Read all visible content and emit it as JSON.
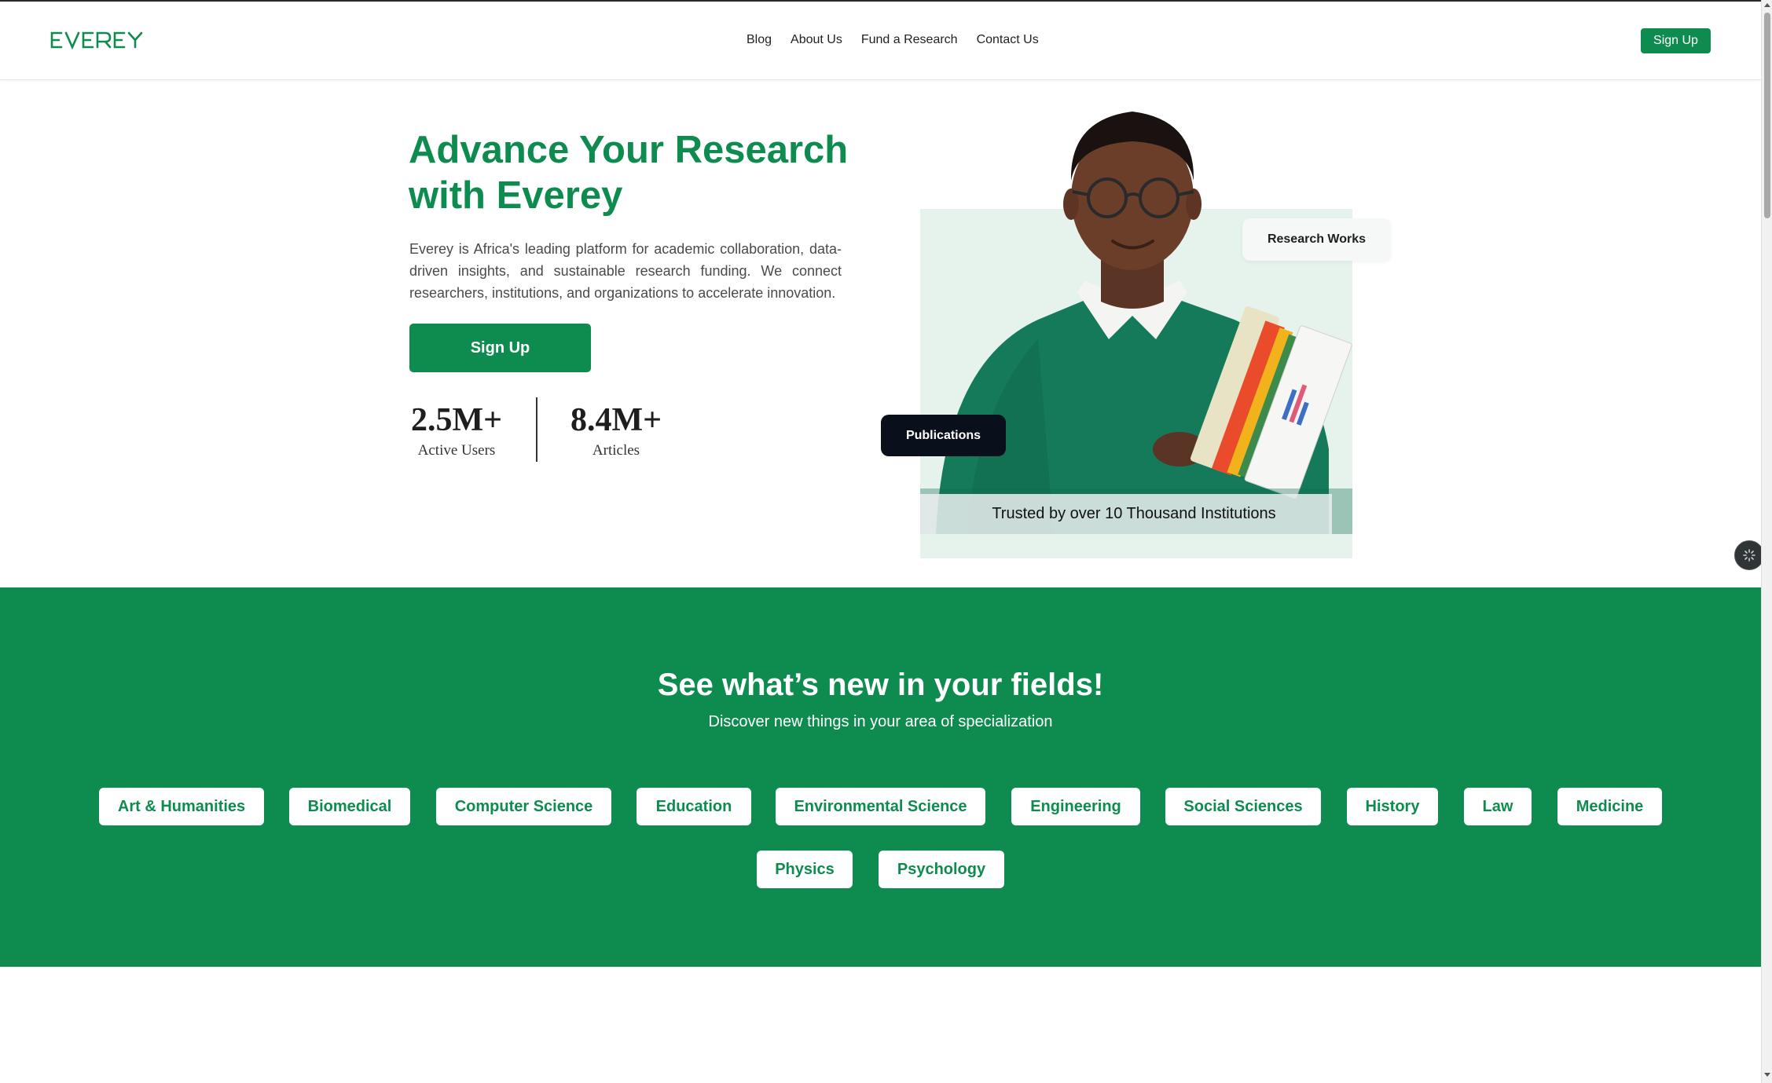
{
  "header": {
    "logo_text": "EVEREY",
    "nav": [
      "Blog",
      "About Us",
      "Fund a Research",
      "Contact Us"
    ],
    "signup_label": "Sign Up"
  },
  "hero": {
    "title_line1": "Advance Your Research",
    "title_line2": "with Everey",
    "description": "Everey is Africa's leading platform for academic collaboration, data-driven insights, and sustainable research funding. We connect researchers, institutions, and organizations to accelerate innovation.",
    "signup_label": "Sign Up",
    "stats": [
      {
        "value": "2.5M+",
        "label": "Active Users"
      },
      {
        "value": "8.4M+",
        "label": "Articles"
      }
    ],
    "chip_research": "Research Works",
    "chip_publications": "Publications",
    "caption": "Trusted by over 10 Thousand Institutions"
  },
  "fields": {
    "title": "See what’s new in your fields!",
    "subtitle": "Discover new things in your area of specialization",
    "items": [
      "Art & Humanities",
      "Biomedical",
      "Computer Science",
      "Education",
      "Environmental Science",
      "Engineering",
      "Social Sciences",
      "History",
      "Law",
      "Medicine",
      "Physics",
      "Psychology"
    ]
  },
  "colors": {
    "brand_green": "#0e8c4f",
    "dark_chip": "#0a0f1c",
    "hero_bg": "#e6f2ec"
  }
}
